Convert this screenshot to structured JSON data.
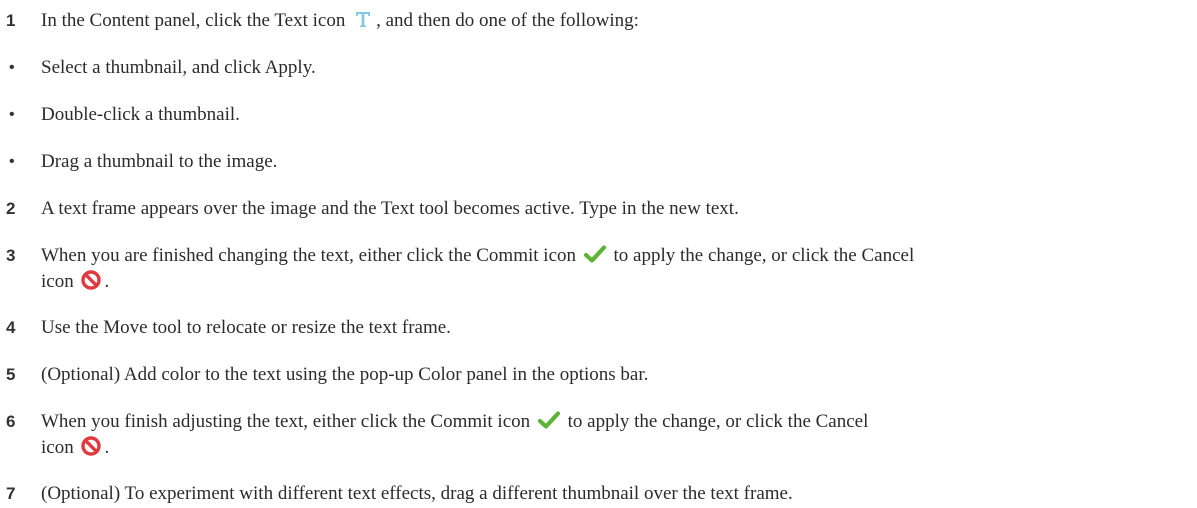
{
  "steps": [
    {
      "marker": "1",
      "parts": [
        "In the Content panel, click the Text icon ",
        ", and then do one of the following:"
      ],
      "icon": "text-icon"
    },
    {
      "marker": "•",
      "text": "Select a thumbnail, and click Apply."
    },
    {
      "marker": "•",
      "text": "Double-click a thumbnail."
    },
    {
      "marker": "•",
      "text": "Drag a thumbnail to the image."
    },
    {
      "marker": "2",
      "text": "A text frame appears over the image and the Text tool becomes active. Type in the new text."
    },
    {
      "marker": "3",
      "parts": [
        "When you are finished changing the text, either click the Commit icon ",
        " to apply the change, or click the Cancel",
        "icon ",
        "."
      ],
      "icons": [
        "commit-icon",
        "cancel-icon"
      ]
    },
    {
      "marker": "4",
      "text": "Use the Move tool to relocate or resize the text frame."
    },
    {
      "marker": "5",
      "text": "(Optional) Add color to the text using the pop-up Color panel in the options bar."
    },
    {
      "marker": "6",
      "parts": [
        "When you finish adjusting the text, either click the Commit icon ",
        " to apply the change, or click the Cancel",
        "icon ",
        "."
      ],
      "icons": [
        "commit-icon",
        "cancel-icon"
      ]
    },
    {
      "marker": "7",
      "text": "(Optional) To experiment with different text effects, drag a different thumbnail over the text frame."
    }
  ],
  "colors": {
    "text_icon": "#7ec9e3",
    "commit_icon": "#5cb335",
    "cancel_icon": "#e0393e"
  }
}
